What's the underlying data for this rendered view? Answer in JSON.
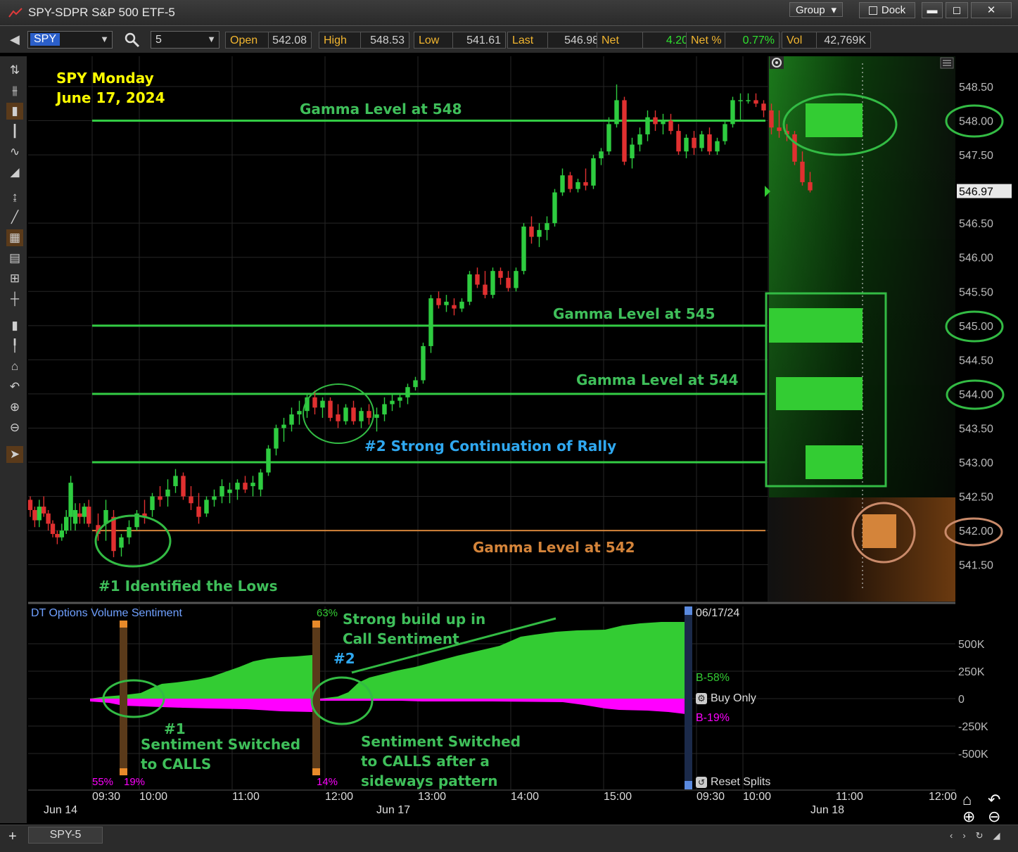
{
  "app": {
    "title": "SPY-SDPR S&P 500 ETF-5",
    "group_label": "Group",
    "dock_label": "Dock",
    "minimize": "▬",
    "maximize": "◻",
    "close": "✕"
  },
  "toolbar": {
    "symbol": "SPY",
    "interval": "5",
    "quotes": [
      {
        "label": "Open",
        "value": "542.08",
        "color": "#cfcfcf"
      },
      {
        "label": "High",
        "value": "548.53",
        "color": "#cfcfcf"
      },
      {
        "label": "Low",
        "value": "541.61",
        "color": "#cfcfcf"
      },
      {
        "label": "Last",
        "value": "546.98",
        "color": "#cfcfcf"
      },
      {
        "label": "Net",
        "value": "4.20",
        "color": "#2fe02f"
      },
      {
        "label": "Net %",
        "value": "0.77%",
        "color": "#2fe02f"
      },
      {
        "label": "Vol",
        "value": "42,769K",
        "color": "#cfcfcf"
      }
    ]
  },
  "annotations": {
    "title_line1": "SPY Monday",
    "title_line2": "June 17, 2024",
    "gamma548": "Gamma Level at 548",
    "gamma545": "Gamma Level at 545",
    "gamma544": "Gamma Level at 544",
    "gamma542": "Gamma Level at 542",
    "note1": "#1 Identified the Lows",
    "note2": "#2 Strong Continuation of Rally",
    "sent_note1_a": "#1",
    "sent_note1_b": "Sentiment Switched",
    "sent_note1_c": "to CALLS",
    "sent_note2_tag": "#2",
    "sent_note2_a": "Strong build up in",
    "sent_note2_b": "Call Sentiment",
    "sent_note3_a": "Sentiment Switched",
    "sent_note3_b": "to CALLS after a",
    "sent_note3_c": "sideways pattern"
  },
  "sentiment_panel": {
    "title": "DT Options Volume Sentiment",
    "date": "06/17/24",
    "call_label": "B-58%",
    "put_label": "B-19%",
    "buy_only": "Buy Only",
    "reset_splits": "Reset Splits",
    "pct_top_mid": "63%",
    "pct_left_call": "55%",
    "pct_left_put": "19%",
    "pct_mid_put": "14%",
    "y_ticks": [
      "500K",
      "250K",
      "0",
      "-250K",
      "-500K"
    ]
  },
  "colors": {
    "up": "#2ecc40",
    "down": "#e03030",
    "gamma": "#33cc44",
    "gamma542": "#d4843a",
    "label_green": "#3fbf5a",
    "label_blue": "#2fa8f0",
    "label_yellow": "#ffff00",
    "label_orange": "#d4843a",
    "call_fill": "#33cc33",
    "put_fill": "#ff00ff"
  },
  "chart_data": {
    "type": "candlestick",
    "price_ticks": [
      "548.50",
      "548.00",
      "547.50",
      "546.97",
      "546.50",
      "546.00",
      "545.50",
      "545.00",
      "544.50",
      "544.00",
      "543.50",
      "543.00",
      "542.50",
      "542.00",
      "541.50"
    ],
    "price_axis_range": [
      541.0,
      549.0
    ],
    "last_price": 546.97,
    "gamma_levels": [
      548,
      545,
      544,
      543,
      542
    ],
    "time_labels": [
      "09:30",
      "10:00",
      "11:00",
      "12:00",
      "13:00",
      "14:00",
      "15:00",
      "09:30",
      "10:00",
      "11:00",
      "12:00"
    ],
    "date_labels": [
      "Jun 14",
      "Jun 17",
      "Jun 18"
    ],
    "prior_day_candles": [
      [
        542.45,
        542.5,
        542.2,
        542.3
      ],
      [
        542.3,
        542.35,
        542.05,
        542.15
      ],
      [
        542.15,
        542.45,
        542.05,
        542.35
      ],
      [
        542.35,
        542.5,
        542.2,
        542.25
      ],
      [
        542.25,
        542.3,
        542.0,
        542.1
      ],
      [
        542.1,
        542.15,
        541.9,
        541.95
      ],
      [
        541.95,
        542.0,
        541.8,
        541.9
      ],
      [
        541.9,
        542.1,
        541.85,
        542.0
      ],
      [
        542.0,
        542.3,
        541.95,
        542.2
      ],
      [
        542.2,
        542.8,
        542.0,
        542.7
      ],
      [
        542.1,
        542.4,
        542.0,
        542.3
      ],
      [
        542.25,
        542.4,
        542.1,
        542.2
      ],
      [
        542.2,
        542.4,
        542.1,
        542.35
      ],
      [
        542.35,
        542.45,
        542.05,
        542.1
      ]
    ],
    "candles": [
      [
        0,
        542.08,
        542.25,
        541.85,
        541.95
      ],
      [
        1,
        542.1,
        542.45,
        541.85,
        542.3
      ],
      [
        2,
        542.2,
        542.3,
        541.61,
        541.7
      ],
      [
        3,
        541.75,
        541.95,
        541.62,
        541.9
      ],
      [
        4,
        541.9,
        542.15,
        541.8,
        542.05
      ],
      [
        5,
        542.05,
        542.3,
        542.0,
        542.25
      ],
      [
        6,
        542.25,
        542.45,
        542.1,
        542.2
      ],
      [
        7,
        542.3,
        542.55,
        542.2,
        542.5
      ],
      [
        8,
        542.5,
        542.65,
        542.35,
        542.45
      ],
      [
        9,
        542.5,
        542.75,
        542.35,
        542.6
      ],
      [
        10,
        542.65,
        542.9,
        542.55,
        542.8
      ],
      [
        11,
        542.8,
        542.85,
        542.45,
        542.5
      ],
      [
        12,
        542.5,
        542.65,
        542.3,
        542.4
      ],
      [
        13,
        542.35,
        542.55,
        542.1,
        542.2
      ],
      [
        14,
        542.25,
        542.5,
        542.2,
        542.45
      ],
      [
        15,
        542.45,
        542.6,
        542.35,
        542.5
      ],
      [
        16,
        542.5,
        542.75,
        542.4,
        542.65
      ],
      [
        17,
        542.55,
        542.7,
        542.4,
        542.6
      ],
      [
        18,
        542.6,
        542.75,
        542.45,
        542.7
      ],
      [
        19,
        542.7,
        542.8,
        542.55,
        542.6
      ],
      [
        20,
        542.65,
        542.8,
        542.5,
        542.7
      ],
      [
        21,
        542.6,
        542.9,
        542.5,
        542.85
      ],
      [
        22,
        542.85,
        543.25,
        542.8,
        543.2
      ],
      [
        23,
        543.2,
        543.55,
        543.1,
        543.5
      ],
      [
        24,
        543.5,
        543.65,
        543.3,
        543.55
      ],
      [
        25,
        543.55,
        543.8,
        543.45,
        543.7
      ],
      [
        26,
        543.7,
        543.9,
        543.55,
        543.75
      ],
      [
        27,
        543.75,
        544.0,
        543.65,
        543.95
      ],
      [
        28,
        543.95,
        544.05,
        543.7,
        543.8
      ],
      [
        29,
        543.8,
        543.95,
        543.65,
        543.9
      ],
      [
        30,
        543.9,
        543.95,
        543.6,
        543.65
      ],
      [
        31,
        543.7,
        543.85,
        543.5,
        543.6
      ],
      [
        32,
        543.6,
        543.85,
        543.55,
        543.8
      ],
      [
        33,
        543.8,
        543.9,
        543.55,
        543.6
      ],
      [
        34,
        543.6,
        543.8,
        543.5,
        543.75
      ],
      [
        35,
        543.75,
        543.85,
        543.55,
        543.65
      ],
      [
        36,
        543.65,
        543.8,
        543.45,
        543.7
      ],
      [
        37,
        543.7,
        543.95,
        543.6,
        543.85
      ],
      [
        38,
        543.85,
        544.0,
        543.75,
        543.9
      ],
      [
        39,
        543.9,
        544.0,
        543.8,
        543.95
      ],
      [
        40,
        543.95,
        544.15,
        543.85,
        544.1
      ],
      [
        41,
        544.1,
        544.25,
        544.05,
        544.2
      ],
      [
        42,
        544.2,
        544.75,
        544.15,
        544.7
      ],
      [
        43,
        544.7,
        545.45,
        544.6,
        545.4
      ],
      [
        44,
        545.4,
        545.5,
        545.25,
        545.3
      ],
      [
        45,
        545.3,
        545.45,
        545.2,
        545.35
      ],
      [
        46,
        545.3,
        545.4,
        545.15,
        545.25
      ],
      [
        47,
        545.25,
        545.4,
        545.2,
        545.35
      ],
      [
        48,
        545.35,
        545.8,
        545.3,
        545.75
      ],
      [
        49,
        545.75,
        545.85,
        545.55,
        545.6
      ],
      [
        50,
        545.6,
        545.8,
        545.4,
        545.45
      ],
      [
        51,
        545.45,
        545.85,
        545.4,
        545.8
      ],
      [
        52,
        545.8,
        545.85,
        545.6,
        545.7
      ],
      [
        53,
        545.7,
        545.8,
        545.5,
        545.55
      ],
      [
        54,
        545.55,
        545.85,
        545.5,
        545.8
      ],
      [
        55,
        545.8,
        546.5,
        545.75,
        546.45
      ],
      [
        56,
        546.45,
        546.6,
        546.2,
        546.3
      ],
      [
        57,
        546.3,
        546.5,
        546.15,
        546.4
      ],
      [
        58,
        546.4,
        546.6,
        546.25,
        546.5
      ],
      [
        59,
        546.5,
        547.0,
        546.45,
        546.95
      ],
      [
        60,
        546.95,
        547.3,
        546.9,
        547.2
      ],
      [
        61,
        547.2,
        547.25,
        546.95,
        547.0
      ],
      [
        62,
        547.0,
        547.15,
        546.95,
        547.1
      ],
      [
        63,
        547.1,
        547.3,
        546.98,
        547.05
      ],
      [
        64,
        547.05,
        547.5,
        547.0,
        547.45
      ],
      [
        65,
        547.45,
        547.6,
        547.35,
        547.55
      ],
      [
        66,
        547.55,
        548.05,
        547.5,
        547.95
      ],
      [
        67,
        547.95,
        548.53,
        547.9,
        548.3
      ],
      [
        68,
        548.3,
        548.35,
        547.35,
        547.4
      ],
      [
        69,
        547.45,
        547.75,
        547.3,
        547.65
      ],
      [
        70,
        547.65,
        547.9,
        547.55,
        547.8
      ],
      [
        71,
        547.8,
        548.15,
        547.7,
        548.05
      ],
      [
        72,
        548.05,
        548.15,
        547.85,
        547.95
      ],
      [
        73,
        547.95,
        548.1,
        547.8,
        548.0
      ],
      [
        74,
        548.0,
        548.1,
        547.8,
        547.85
      ],
      [
        75,
        547.85,
        547.95,
        547.5,
        547.55
      ],
      [
        76,
        547.55,
        547.8,
        547.45,
        547.75
      ],
      [
        77,
        547.75,
        547.85,
        547.5,
        547.6
      ],
      [
        78,
        547.6,
        547.85,
        547.55,
        547.8
      ],
      [
        79,
        547.8,
        547.9,
        547.5,
        547.55
      ],
      [
        80,
        547.55,
        547.75,
        547.5,
        547.7
      ],
      [
        81,
        547.7,
        548.0,
        547.65,
        547.95
      ],
      [
        82,
        547.95,
        548.35,
        547.9,
        548.3
      ],
      [
        83,
        548.3,
        548.4,
        548.0,
        548.3
      ],
      [
        84,
        548.3,
        548.4,
        548.25,
        548.3
      ],
      [
        85,
        548.3,
        548.4,
        548.2,
        548.25
      ],
      [
        86,
        548.25,
        548.3,
        548.05,
        548.15
      ],
      [
        87,
        548.15,
        548.25,
        547.8,
        547.9
      ],
      [
        88,
        547.9,
        548.15,
        547.75,
        547.85
      ],
      [
        89,
        547.85,
        547.95,
        547.7,
        547.8
      ],
      [
        90,
        547.8,
        547.85,
        547.35,
        547.4
      ],
      [
        91,
        547.4,
        547.55,
        547.05,
        547.1
      ],
      [
        92,
        547.1,
        547.25,
        546.95,
        546.98
      ]
    ]
  }
}
